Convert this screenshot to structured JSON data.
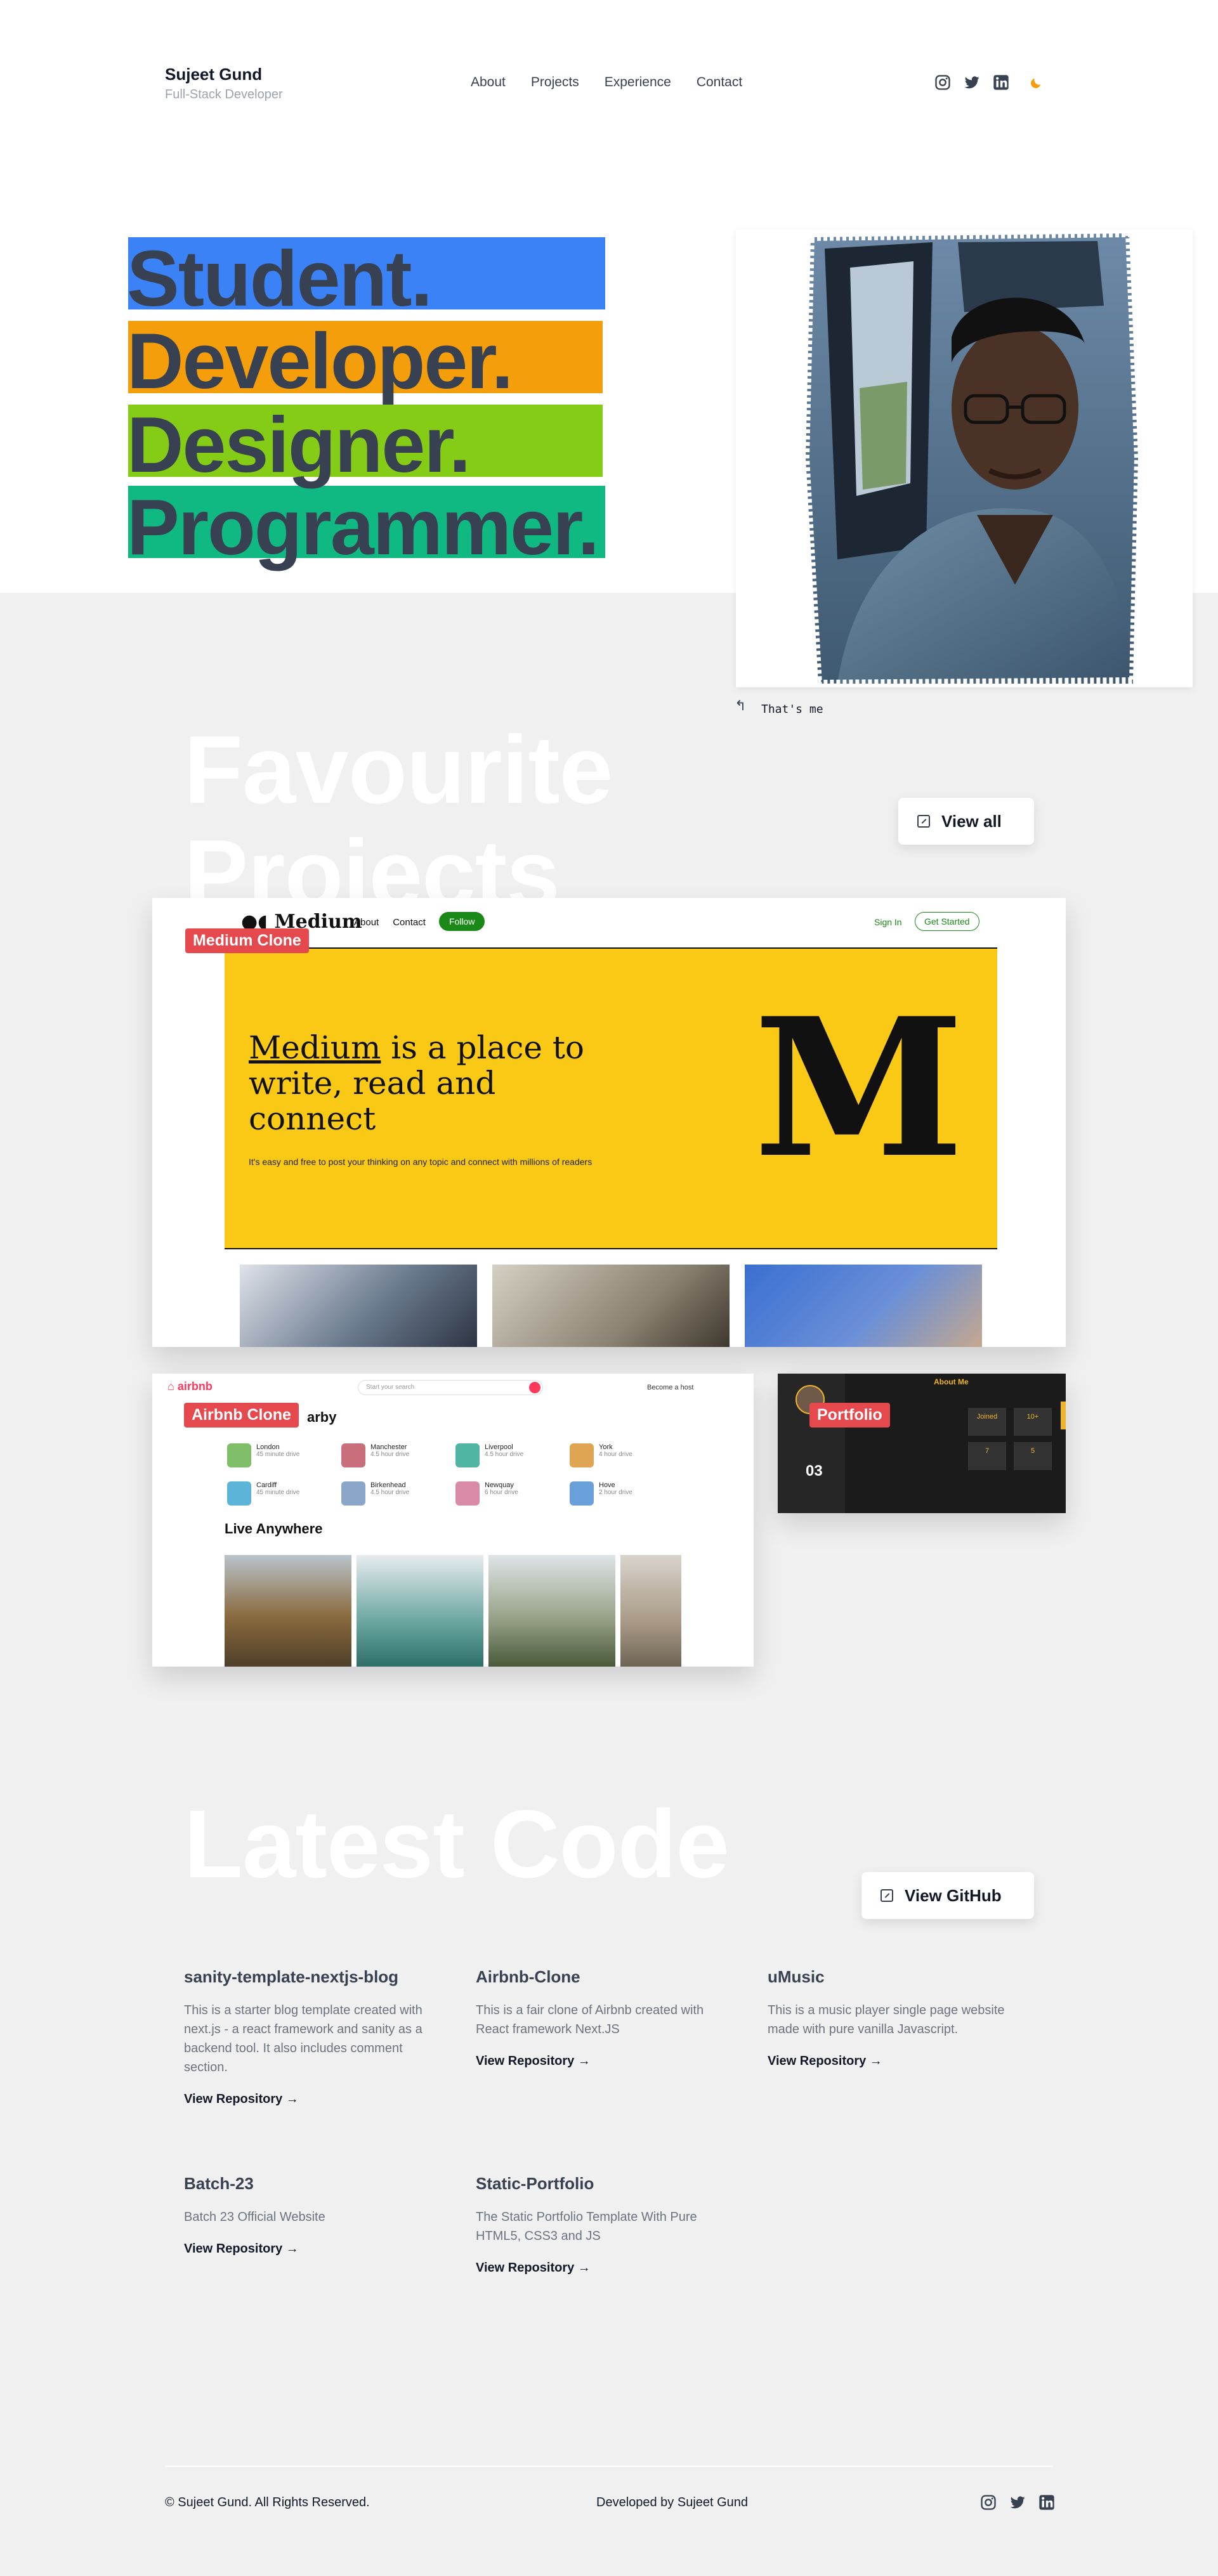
{
  "header": {
    "name": "Sujeet Gund",
    "role": "Full-Stack Developer",
    "nav": [
      "About",
      "Projects",
      "Experience",
      "Contact"
    ],
    "social_icons": [
      "instagram-icon",
      "twitter-icon",
      "linkedin-icon"
    ],
    "theme_icon": "moon-icon"
  },
  "hero": {
    "lines": [
      {
        "text": "Student.",
        "color": "#3b82f6"
      },
      {
        "text": "Developer.",
        "color": "#f59e0b"
      },
      {
        "text": "Designer.",
        "color": "#84cc16"
      },
      {
        "text": "Programmer.",
        "color": "#10b981"
      }
    ],
    "photo_caption": "That's me"
  },
  "projects": {
    "heading": "Favourite Projects",
    "view_all": "View all",
    "medium": {
      "badge": "Medium Clone",
      "logo": "Medium",
      "nav": [
        "About",
        "Contact"
      ],
      "follow": "Follow",
      "sign_in": "Sign In",
      "get_started": "Get Started",
      "headline_word": "Medium",
      "headline_rest": " is a place to write, read and connect",
      "subtitle": "It's easy and free to post your thinking on any topic and connect with millions of readers",
      "big_letter": "M"
    },
    "airbnb": {
      "badge": "Airbnb Clone",
      "logo": "airbnb",
      "search_placeholder": "Start your search",
      "host": "Become a host",
      "section_partial": "arby",
      "places": [
        {
          "city": "London",
          "time": "45 minute drive",
          "color": "#7fbf6a"
        },
        {
          "city": "Manchester",
          "time": "4.5 hour drive",
          "color": "#c96f7b"
        },
        {
          "city": "Liverpool",
          "time": "4.5 hour drive",
          "color": "#4fb6a3"
        },
        {
          "city": "York",
          "time": "4 hour drive",
          "color": "#e0a552"
        },
        {
          "city": "Cardiff",
          "time": "45 minute drive",
          "color": "#5cb4d8"
        },
        {
          "city": "Birkenhead",
          "time": "4.5 hour drive",
          "color": "#8aa6c9"
        },
        {
          "city": "Newquay",
          "time": "6 hour drive",
          "color": "#d98aa8"
        },
        {
          "city": "Hove",
          "time": "2 hour drive",
          "color": "#6aa0d9"
        }
      ],
      "live_anywhere": "Live Anywhere"
    },
    "portfolio": {
      "badge": "Portfolio",
      "title": "About Me",
      "number": "03",
      "stats": [
        "Joined",
        "10+",
        "7",
        "5"
      ]
    }
  },
  "code": {
    "heading": "Latest Code",
    "view_github": "View GitHub",
    "repos": [
      {
        "title": "sanity-template-nextjs-blog",
        "desc": "This is a starter blog template created with next.js - a react framework and sanity as a backend tool. It also includes comment section.",
        "link": "View Repository →"
      },
      {
        "title": "Airbnb-Clone",
        "desc": "This is a fair clone of Airbnb created with React framework Next.JS",
        "link": "View Repository →"
      },
      {
        "title": "uMusic",
        "desc": "This is a music player single page website made with pure vanilla Javascript.",
        "link": "View Repository →"
      },
      {
        "title": "Batch-23",
        "desc": "Batch 23 Official Website",
        "link": "View Repository →"
      },
      {
        "title": "Static-Portfolio",
        "desc": "The Static Portfolio Template With Pure HTML5, CSS3 and JS",
        "link": "View Repository →"
      }
    ]
  },
  "footer": {
    "copyright": "© Sujeet Gund. All Rights Reserved.",
    "developed_by": "Developed by  Sujeet Gund"
  }
}
